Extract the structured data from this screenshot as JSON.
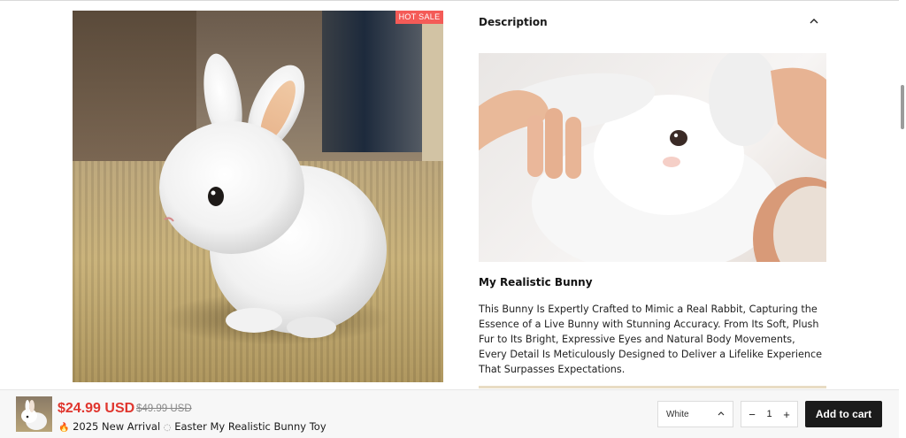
{
  "product": {
    "badge": "HOT SALE",
    "main_image_alt": "white fluffy bunny on rug",
    "description": {
      "heading": "Description",
      "toggle_icon": "chevron-up-icon",
      "image_alt": "hands holding plush bunny",
      "subtitle": "My Realistic Bunny",
      "body": "This Bunny Is Expertly Crafted to Mimic a Real Rabbit, Capturing the Essence of a Live Bunny with Stunning Accuracy. From Its Soft, Plush Fur to Its Bright, Expressive Eyes and Natural Body Movements, Every Detail Is Meticulously Designed to Deliver a Lifelike Experience That Surpasses Expectations."
    }
  },
  "sticky_bar": {
    "price": "$24.99 USD",
    "compare_price": "$49.99 USD",
    "title_prefix_icon": "fire-icon",
    "title_part1": "2025 New Arrival",
    "title_mid_icon": "spinner-icon",
    "title_part2": "Easter My Realistic Bunny Toy",
    "variant": {
      "selected": "White",
      "icon": "chevron-up-icon"
    },
    "quantity": {
      "minus": "−",
      "value": "1",
      "plus": "+"
    },
    "add_to_cart": "Add to cart"
  },
  "colors": {
    "badge_bg": "#f45b57",
    "price": "#e0362e",
    "button_bg": "#1b1b1b"
  }
}
